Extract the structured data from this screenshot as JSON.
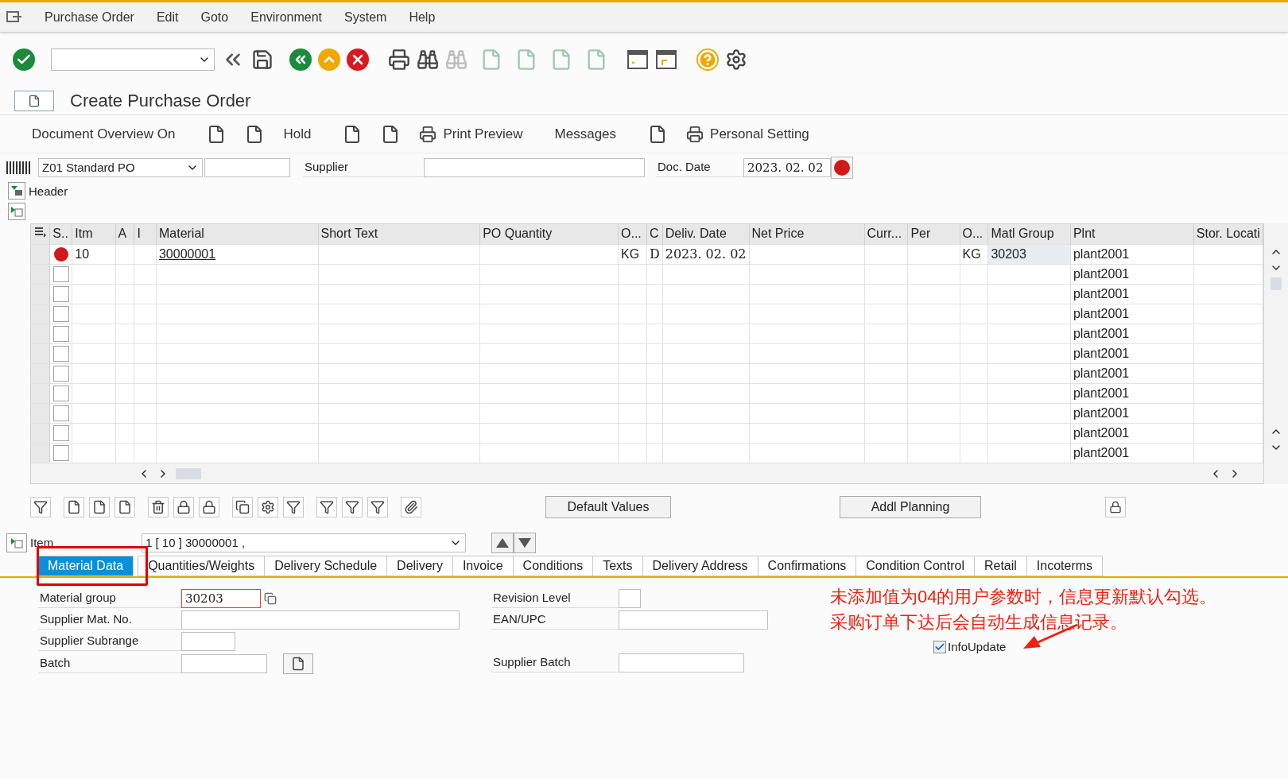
{
  "menu_bar": {
    "items": [
      "Purchase Order",
      "Edit",
      "Goto",
      "Environment",
      "System",
      "Help"
    ]
  },
  "title": "Create Purchase Order",
  "app_toolbar": {
    "items": [
      {
        "kind": "text",
        "label": "Document Overview On"
      },
      {
        "kind": "icon"
      },
      {
        "kind": "icon"
      },
      {
        "kind": "text",
        "label": "Hold"
      },
      {
        "kind": "icon"
      },
      {
        "kind": "icon"
      },
      {
        "kind": "icon_text",
        "label": "Print Preview"
      },
      {
        "kind": "text",
        "label": "Messages"
      },
      {
        "kind": "icon"
      },
      {
        "kind": "icon_text",
        "label": "Personal Setting"
      }
    ]
  },
  "header": {
    "doc_type": "Z01 Standard PO",
    "supplier_label": "Supplier",
    "doc_date_label": "Doc. Date",
    "doc_date": "2023. 02. 02",
    "section_label": "Header"
  },
  "grid": {
    "columns": [
      "S..",
      "Itm",
      "A",
      "I",
      "Material",
      "Short Text",
      "PO Quantity",
      "O...",
      "C",
      "Deliv. Date",
      "Net Price",
      "Curr...",
      "Per",
      "O...",
      "Matl Group",
      "Plnt",
      "Stor. Locati"
    ],
    "rows": [
      {
        "kind": "error",
        "item": "10",
        "material": "30000001",
        "order_unit": "KG",
        "c": "D",
        "deliv_date": "2023. 02. 02",
        "price_unit": "KG",
        "matl_group": "30203",
        "plant": "plant2001"
      },
      {
        "kind": "checkbox",
        "checked": false,
        "plant": "plant2001"
      },
      {
        "kind": "checkbox",
        "checked": false,
        "plant": "plant2001"
      },
      {
        "kind": "checkbox",
        "checked": false,
        "plant": "plant2001"
      },
      {
        "kind": "checkbox",
        "checked": false,
        "plant": "plant2001"
      },
      {
        "kind": "checkbox",
        "checked": false,
        "plant": "plant2001"
      },
      {
        "kind": "checkbox",
        "checked": false,
        "plant": "plant2001"
      },
      {
        "kind": "checkbox",
        "checked": false,
        "plant": "plant2001"
      },
      {
        "kind": "checkbox",
        "checked": false,
        "plant": "plant2001"
      },
      {
        "kind": "checkbox",
        "checked": false,
        "plant": "plant2001"
      },
      {
        "kind": "checkbox",
        "checked": false,
        "plant": "plant2001"
      }
    ]
  },
  "grid_buttons": [
    "Default Values",
    "Addl Planning"
  ],
  "item": {
    "label": "Item",
    "value": "1 [ 10 ] 30000001 ,"
  },
  "tabs": [
    {
      "label": "Material Data",
      "selected": true
    },
    {
      "label": "Quantities/Weights",
      "selected": false
    },
    {
      "label": "Delivery Schedule",
      "selected": false
    },
    {
      "label": "Delivery",
      "selected": false
    },
    {
      "label": "Invoice",
      "selected": false
    },
    {
      "label": "Conditions",
      "selected": false
    },
    {
      "label": "Texts",
      "selected": false
    },
    {
      "label": "Delivery Address",
      "selected": false
    },
    {
      "label": "Confirmations",
      "selected": false
    },
    {
      "label": "Condition Control",
      "selected": false
    },
    {
      "label": "Retail",
      "selected": false
    },
    {
      "label": "Incoterms",
      "selected": false
    }
  ],
  "material_data": {
    "material_group": {
      "label": "Material group",
      "value": "30203"
    },
    "supplier_mat_no": {
      "label": "Supplier Mat. No."
    },
    "supplier_subrange": {
      "label": "Supplier Subrange"
    },
    "batch": {
      "label": "Batch"
    },
    "revision_level": {
      "label": "Revision Level"
    },
    "ean_upc": {
      "label": "EAN/UPC"
    },
    "supplier_batch": {
      "label": "Supplier Batch"
    },
    "info_update": {
      "label": "InfoUpdate",
      "checked": true
    }
  },
  "annotation": {
    "lines": [
      "未添加值为04的用户参数时，信息更新默认勾选。",
      "采购订单下达后会自动生成信息记录。"
    ]
  }
}
